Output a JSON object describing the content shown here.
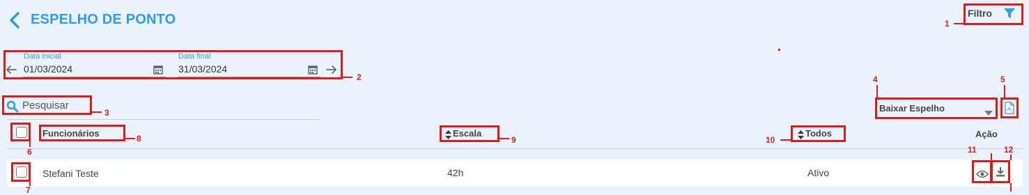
{
  "header": {
    "title": "ESPELHO DE PONTO",
    "filter_label": "Filtro",
    "back_icon": "chevron-left-icon",
    "filter_icon": "filter-icon"
  },
  "dates": {
    "start_label": "Data inicial",
    "start_value": "01/03/2024",
    "end_label": "Data final",
    "end_value": "31/03/2024"
  },
  "search": {
    "placeholder": "Pesquisar"
  },
  "download": {
    "select_value": "Baixar Espelho",
    "pdf_icon": "pdf-file-icon"
  },
  "table": {
    "columns": {
      "employees": "Funcionários",
      "schedule": "Escala",
      "status": "Todos",
      "action": "Ação"
    },
    "rows": [
      {
        "name": "Stefani Teste",
        "schedule": "42h",
        "status": "Ativo"
      }
    ]
  },
  "annotations": [
    "1",
    "2",
    "3",
    "4",
    "5",
    "6",
    "7",
    "8",
    "9",
    "10",
    "11",
    "12"
  ],
  "colors": {
    "accent": "#2e9bf0",
    "annotation": "#e01818",
    "background": "#eaf3fc"
  }
}
